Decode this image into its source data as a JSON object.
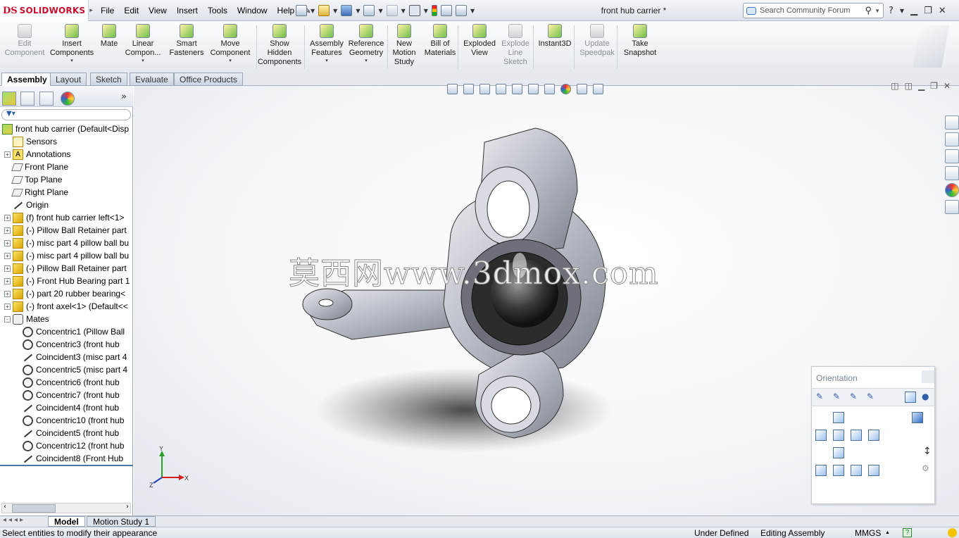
{
  "app": {
    "logo_mark": "DS",
    "logo_text": "SOLIDWORKS",
    "doc_title": "front hub carrier *"
  },
  "menu": [
    "File",
    "Edit",
    "View",
    "Insert",
    "Tools",
    "Window",
    "Help"
  ],
  "search": {
    "placeholder": "Search Community Forum"
  },
  "command_manager": [
    {
      "label1": "Edit",
      "label2": "Component",
      "icon": "edit-component-icon",
      "disabled": true
    },
    {
      "label1": "Insert",
      "label2": "Components",
      "icon": "insert-components-icon",
      "dropdown": true
    },
    {
      "label1": "Mate",
      "label2": "",
      "icon": "mate-icon"
    },
    {
      "label1": "Linear",
      "label2": "Compon...",
      "icon": "linear-pattern-icon",
      "dropdown": true
    },
    {
      "label1": "Smart",
      "label2": "Fasteners",
      "icon": "smart-fasteners-icon"
    },
    {
      "label1": "Move",
      "label2": "Component",
      "icon": "move-component-icon",
      "dropdown": true
    },
    {
      "label1": "Show",
      "label2": "Hidden",
      "label3": "Components",
      "icon": "show-hidden-icon"
    },
    {
      "label1": "Assembly",
      "label2": "Features",
      "icon": "assembly-features-icon",
      "dropdown": true
    },
    {
      "label1": "Reference",
      "label2": "Geometry",
      "icon": "reference-geometry-icon",
      "dropdown": true
    },
    {
      "label1": "New",
      "label2": "Motion",
      "label3": "Study",
      "icon": "motion-study-icon"
    },
    {
      "label1": "Bill of",
      "label2": "Materials",
      "icon": "bom-icon"
    },
    {
      "label1": "Exploded",
      "label2": "View",
      "icon": "exploded-view-icon"
    },
    {
      "label1": "Explode",
      "label2": "Line",
      "label3": "Sketch",
      "icon": "explode-line-icon",
      "disabled": true
    },
    {
      "label1": "Instant3D",
      "label2": "",
      "icon": "instant3d-icon"
    },
    {
      "label1": "Update",
      "label2": "Speedpak",
      "icon": "speedpak-icon",
      "disabled": true
    },
    {
      "label1": "Take",
      "label2": "Snapshot",
      "icon": "snapshot-icon"
    }
  ],
  "tabs": [
    "Assembly",
    "Layout",
    "Sketch",
    "Evaluate",
    "Office Products"
  ],
  "tree": [
    {
      "label": "front hub carrier  (Default<Disp",
      "icon": "assembly-icon",
      "level": 0,
      "expander": ""
    },
    {
      "label": "Sensors",
      "icon": "sensors-icon",
      "level": 1,
      "expander": ""
    },
    {
      "label": "Annotations",
      "icon": "annotations-icon",
      "level": 1,
      "expander": "+"
    },
    {
      "label": "Front Plane",
      "icon": "plane-icon",
      "level": 1,
      "expander": ""
    },
    {
      "label": "Top Plane",
      "icon": "plane-icon",
      "level": 1,
      "expander": ""
    },
    {
      "label": "Right Plane",
      "icon": "plane-icon",
      "level": 1,
      "expander": ""
    },
    {
      "label": "Origin",
      "icon": "origin-icon",
      "level": 1,
      "expander": ""
    },
    {
      "label": "(f) front hub carrier left<1>",
      "icon": "part-icon",
      "level": 1,
      "expander": "+"
    },
    {
      "label": "(-) Pillow Ball Retainer part",
      "icon": "part-icon",
      "level": 1,
      "expander": "+"
    },
    {
      "label": "(-) misc part 4 pillow ball bu",
      "icon": "part-icon",
      "level": 1,
      "expander": "+"
    },
    {
      "label": "(-) misc part 4 pillow ball bu",
      "icon": "part-icon",
      "level": 1,
      "expander": "+"
    },
    {
      "label": "(-) Pillow Ball Retainer part",
      "icon": "part-icon",
      "level": 1,
      "expander": "+"
    },
    {
      "label": "(-) Front Hub Bearing part 1",
      "icon": "part-icon",
      "level": 1,
      "expander": "+"
    },
    {
      "label": "(-) part 20 rubber bearing<",
      "icon": "part-icon",
      "level": 1,
      "expander": "+"
    },
    {
      "label": "(-) front axel<1> (Default<<",
      "icon": "part-icon",
      "level": 1,
      "expander": "+"
    },
    {
      "label": "Mates",
      "icon": "mates-icon",
      "level": 1,
      "expander": "-"
    },
    {
      "label": "Concentric1 (Pillow Ball",
      "icon": "concentric-icon",
      "level": 2,
      "expander": ""
    },
    {
      "label": "Concentric3 (front hub",
      "icon": "concentric-icon",
      "level": 2,
      "expander": ""
    },
    {
      "label": "Coincident3 (misc part 4",
      "icon": "coincident-icon",
      "level": 2,
      "expander": ""
    },
    {
      "label": "Concentric5 (misc part 4",
      "icon": "concentric-icon",
      "level": 2,
      "expander": ""
    },
    {
      "label": "Concentric6 (front hub",
      "icon": "concentric-icon",
      "level": 2,
      "expander": ""
    },
    {
      "label": "Concentric7 (front hub",
      "icon": "concentric-icon",
      "level": 2,
      "expander": ""
    },
    {
      "label": "Coincident4 (front hub",
      "icon": "coincident-icon",
      "level": 2,
      "expander": ""
    },
    {
      "label": "Concentric10 (front hub",
      "icon": "concentric-icon",
      "level": 2,
      "expander": ""
    },
    {
      "label": "Coincident5 (front hub",
      "icon": "coincident-icon",
      "level": 2,
      "expander": ""
    },
    {
      "label": "Concentric12 (front hub",
      "icon": "concentric-icon",
      "level": 2,
      "expander": ""
    },
    {
      "label": "Coincident8 (Front Hub",
      "icon": "coincident-icon",
      "level": 2,
      "expander": ""
    }
  ],
  "viewport": {
    "watermark": "莫西网www.3dmox.com",
    "triad_x": "X",
    "triad_y": "Y",
    "triad_z": "Z"
  },
  "orientation": {
    "title": "Orientation"
  },
  "bottom_tabs": [
    "Model",
    "Motion Study 1"
  ],
  "status": {
    "message": "Select entities to modify their appearance",
    "state": "Under Defined",
    "mode": "Editing Assembly",
    "units": "MMGS",
    "units_arrow": "▲",
    "help": "?"
  },
  "colors": {
    "brand": "#c8102e",
    "accent": "#4a76a8",
    "panel_bg": "#e6eaef"
  }
}
